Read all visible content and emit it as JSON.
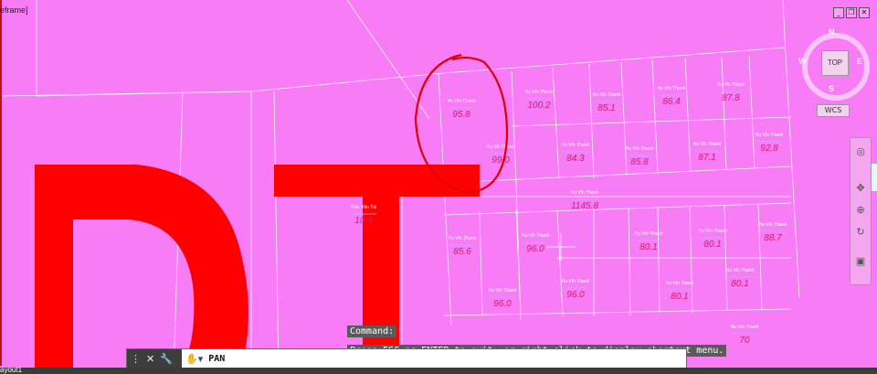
{
  "viewport": {
    "label": "eframe]"
  },
  "window_controls": [
    "_",
    "❐",
    "✕"
  ],
  "viewcube": {
    "north": "N",
    "west": "W",
    "east": "E",
    "south": "S",
    "face": "TOP",
    "wcs": "WCS"
  },
  "big_text": {
    "letters": "DT",
    "color": "#ff0000"
  },
  "background_color": "#f77cf5",
  "annotation": {
    "color": "#e00000"
  },
  "parcels": [
    {
      "owner": "Hu Vĩn Thanh",
      "area": "95.8"
    },
    {
      "owner": "Hu Vĩn Thanh",
      "area": "99.0"
    },
    {
      "owner": "Hu Vĩn Thanh",
      "area": "100.2"
    },
    {
      "owner": "Hu Vĩn Thanh",
      "area": "85.1"
    },
    {
      "owner": "Hu Vĩn Thanh",
      "area": "86.4"
    },
    {
      "owner": "Hu Vĩn Thanh",
      "area": "87.8"
    },
    {
      "owner": "Hu Vĩn Thanh",
      "area": "84.3"
    },
    {
      "owner": "Hu Vĩn Thanh",
      "area": "85.8"
    },
    {
      "owner": "Hu Vĩn Thanh",
      "area": "87.1"
    },
    {
      "owner": "Hu Vĩn Thanh",
      "area": "92.8"
    },
    {
      "owner": "Hu Vĩn Thanh",
      "area": "1145.8"
    },
    {
      "owner": "Trần Văn Tài",
      "area": "10.4"
    },
    {
      "owner": "Hu Vĩn Thanh",
      "area": "85.6"
    },
    {
      "owner": "Hu Vĩn Thanh",
      "area": "96.0"
    },
    {
      "owner": "Hu Vĩn Thanh",
      "area": "80.1"
    },
    {
      "owner": "Hu Vĩn Thanh",
      "area": "80.1"
    },
    {
      "owner": "Hu Vĩn Thanh",
      "area": "88.7"
    },
    {
      "owner": "Hu Vĩn Thanh",
      "area": "96.0"
    },
    {
      "owner": "Hu Vĩn Thanh",
      "area": "96.0"
    },
    {
      "owner": "Hu Vĩn Thanh",
      "area": "80.1"
    },
    {
      "owner": "Hu Vĩn Thanh",
      "area": "80.1"
    },
    {
      "owner": "Hu Vĩn Thanh",
      "area": "70"
    }
  ],
  "command": {
    "history": [
      "Command:",
      "Press ESC or ENTER to exit, or right-click to display shortcut menu."
    ],
    "current": "PAN"
  },
  "layout_tab": "ayout1"
}
